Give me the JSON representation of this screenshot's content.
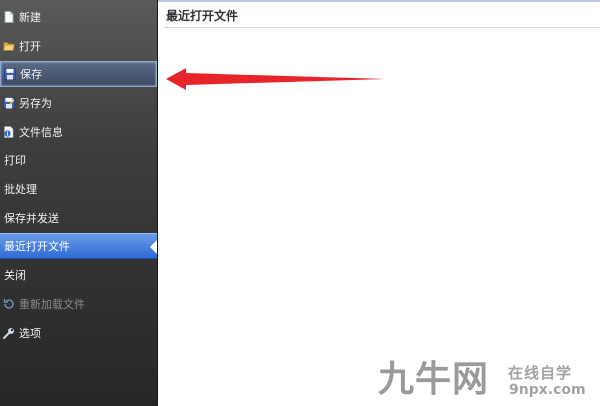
{
  "menu": {
    "items": [
      {
        "label": "新建",
        "icon": "new-document-icon"
      },
      {
        "label": "打开",
        "icon": "folder-open-icon"
      },
      {
        "label": "保存",
        "icon": "floppy-disk-icon",
        "state": "hover"
      },
      {
        "label": "另存为",
        "icon": "save-as-icon"
      },
      {
        "label": "文件信息",
        "icon": "file-info-icon"
      },
      {
        "label": "打印"
      },
      {
        "label": "批处理"
      },
      {
        "label": "保存并发送"
      },
      {
        "label": "最近打开文件",
        "state": "selected"
      },
      {
        "label": "关闭"
      },
      {
        "label": "重新加载文件",
        "icon": "reload-icon",
        "state": "disabled"
      },
      {
        "label": "选项",
        "icon": "wrench-icon"
      }
    ]
  },
  "main": {
    "title": "最近打开文件"
  },
  "watermark": {
    "brand": "九牛网",
    "slogan": "在线自学",
    "url": "9npx.com"
  },
  "colors": {
    "selected_accent": "#3a78dd",
    "annotation_arrow": "#e8242b"
  }
}
